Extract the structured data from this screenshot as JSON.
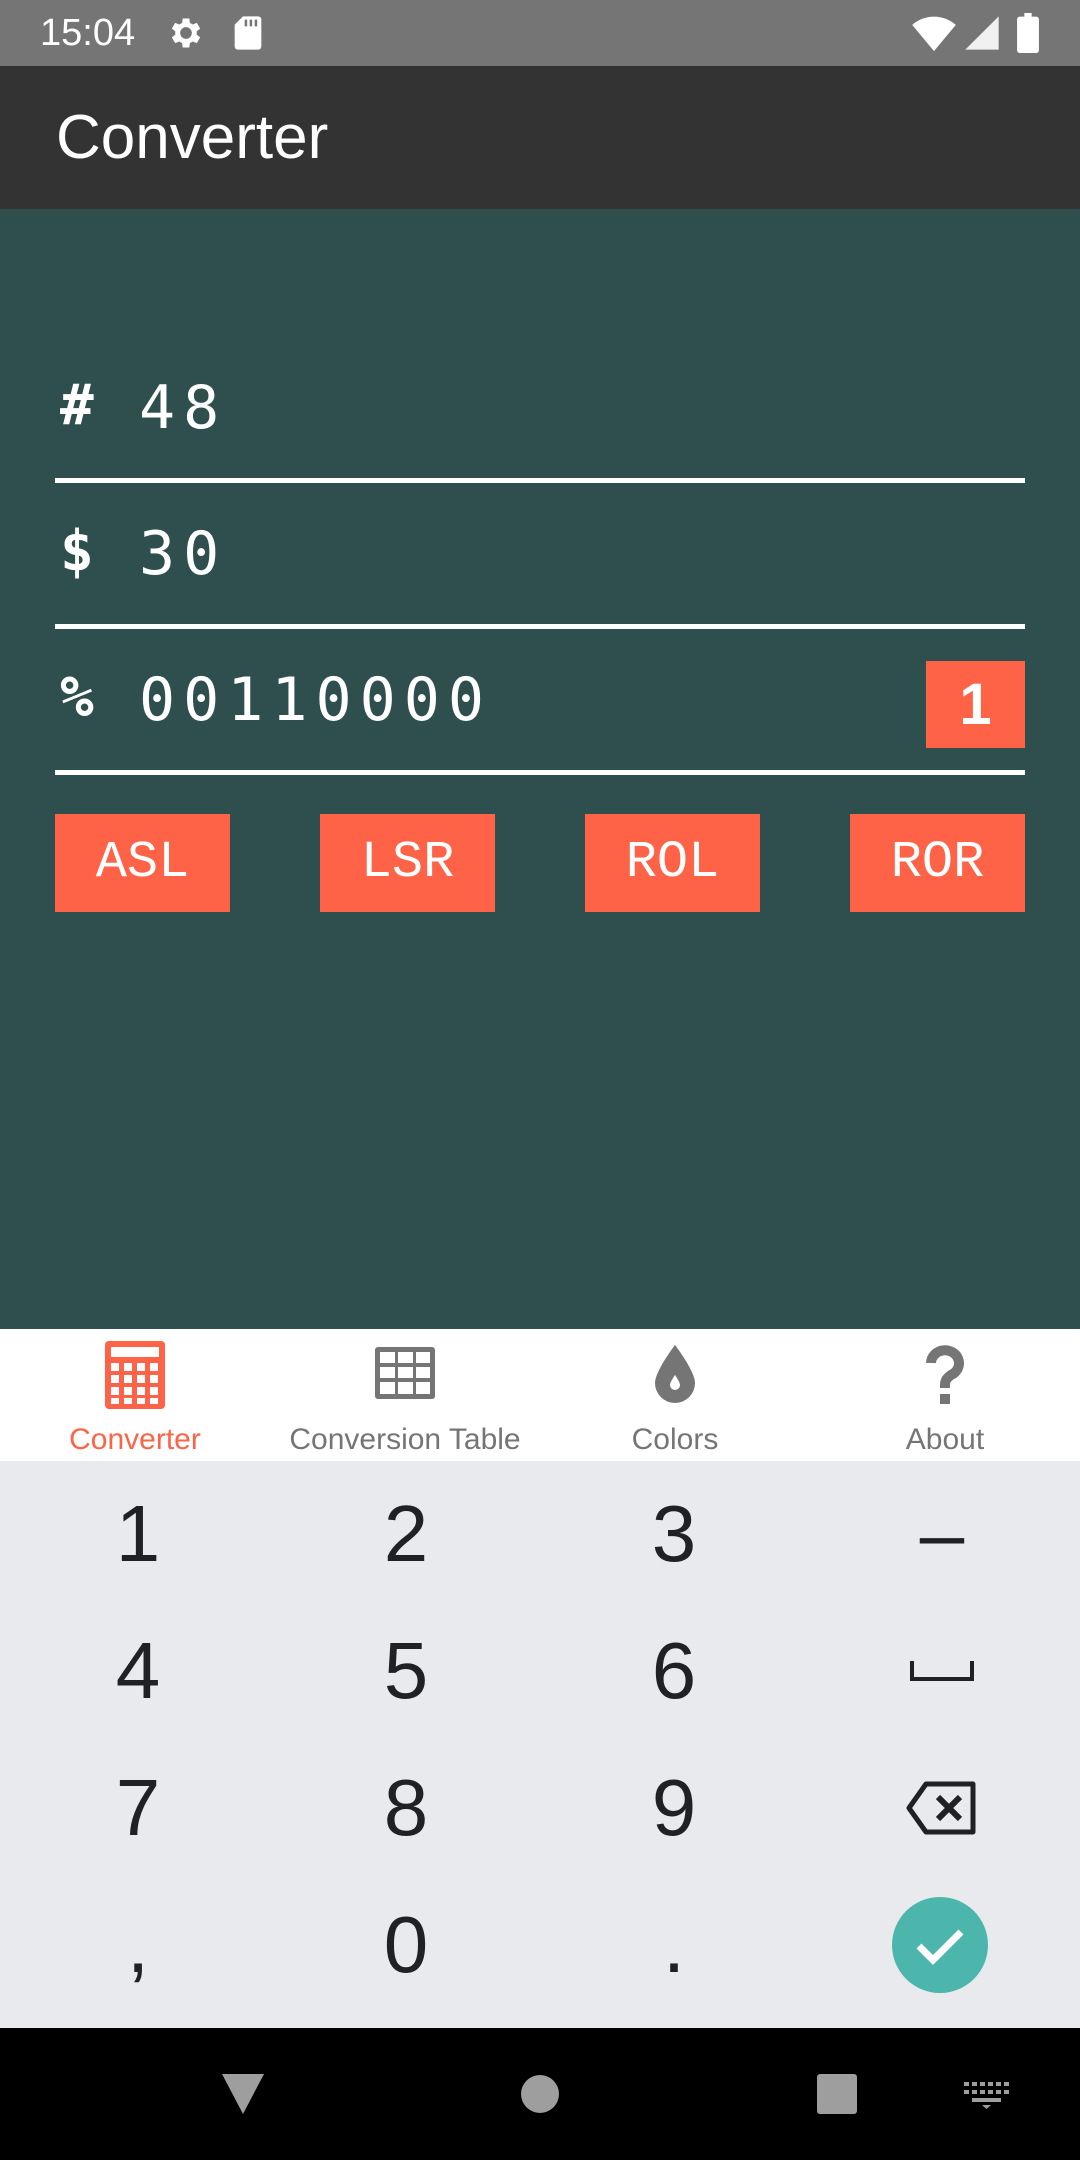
{
  "status_bar": {
    "time": "15:04",
    "left_icons": [
      "gear-icon",
      "sd-card-icon"
    ],
    "right_icons": [
      "wifi-icon",
      "cell-signal-icon",
      "battery-icon"
    ]
  },
  "app_bar": {
    "title": "Converter"
  },
  "converter": {
    "fields": [
      {
        "prefix": "#",
        "value": "48"
      },
      {
        "prefix": "$",
        "value": "30"
      },
      {
        "prefix": "%",
        "value": "00110000"
      }
    ],
    "bit_badge": "1",
    "buttons": [
      "ASL",
      "LSR",
      "ROL",
      "ROR"
    ]
  },
  "bottom_nav": {
    "items": [
      {
        "label": "Converter",
        "icon": "calculator-icon",
        "active": true
      },
      {
        "label": "Conversion Table",
        "icon": "table-grid-icon",
        "active": false
      },
      {
        "label": "Colors",
        "icon": "drop-icon",
        "active": false
      },
      {
        "label": "About",
        "icon": "question-icon",
        "active": false
      }
    ]
  },
  "keyboard": {
    "rows": [
      [
        "1",
        "2",
        "3",
        "–"
      ],
      [
        "4",
        "5",
        "6",
        "space"
      ],
      [
        "7",
        "8",
        "9",
        "backspace"
      ],
      [
        ",",
        "0",
        ".",
        "enter"
      ]
    ]
  },
  "colors": {
    "accent": "#ff6347",
    "background": "#2f4f4f",
    "app_bar": "#333333",
    "enter_key": "#4db6ac"
  }
}
